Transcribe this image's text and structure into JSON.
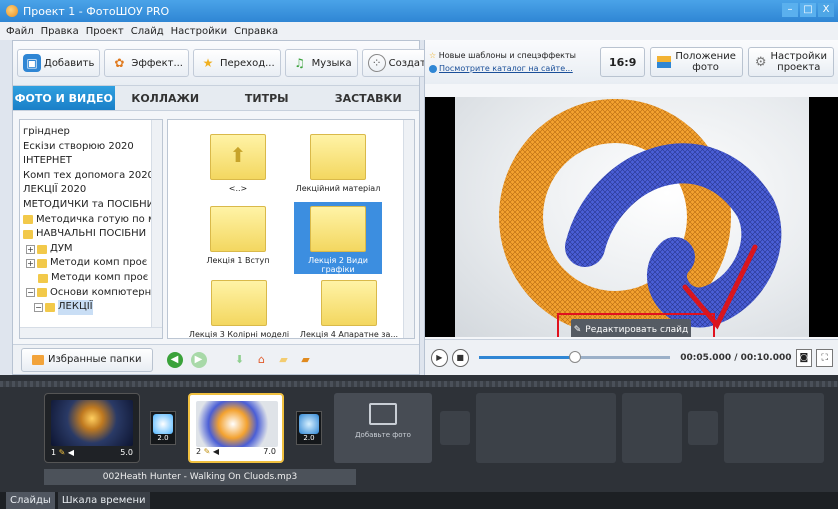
{
  "window": {
    "title": "Проект 1 - ФотоШОУ PRO",
    "controls": [
      "–",
      "□",
      "X"
    ]
  },
  "menu": [
    "Файл",
    "Правка",
    "Проект",
    "Слайд",
    "Настройки",
    "Справка"
  ],
  "toolbar": {
    "add": "Добавить",
    "effects": "Эффект...",
    "transitions": "Переход...",
    "music": "Музыка",
    "create": "Создать"
  },
  "tabs": [
    "ФОТО И ВИДЕО",
    "КОЛЛАЖИ",
    "ТИТРЫ",
    "ЗАСТАВКИ"
  ],
  "tree": [
    {
      "label": "грінднер",
      "type": "plain"
    },
    {
      "label": "Ескізи створюю 2020",
      "type": "plain"
    },
    {
      "label": "ІНТЕРНЕТ",
      "type": "plain"
    },
    {
      "label": "Комп тех допомога 2020",
      "type": "plain"
    },
    {
      "label": "ЛЕКЦІЇ  2020",
      "type": "plain"
    },
    {
      "label": "МЕТОДИЧКИ та ПОСІБНИ",
      "type": "plain"
    },
    {
      "label": "Методичка готую по м",
      "type": "folder"
    },
    {
      "label": "НАВЧАЛЬНІ ПОСІБНИ",
      "type": "folder"
    },
    {
      "label": "ДУМ",
      "type": "expand-folder"
    },
    {
      "label": "Методи комп проє",
      "type": "expand-folder"
    },
    {
      "label": "Методи комп проє",
      "type": "folder-indent"
    },
    {
      "label": "Основи компютерн",
      "type": "collapse-folder"
    },
    {
      "label": "ЛЕКЦІЇ",
      "type": "selected"
    }
  ],
  "thumbnails": [
    {
      "label": "<..>",
      "up": true,
      "selected": false
    },
    {
      "label": "Лекційний матеріал",
      "up": false,
      "selected": false
    },
    {
      "label": "Лекція 1 Вступ",
      "up": false,
      "selected": false
    },
    {
      "label": "Лекція 2 Види графіки",
      "up": false,
      "selected": true
    },
    {
      "label": "Лекція 3 Колірні моделі",
      "up": false,
      "selected": false
    },
    {
      "label": "Лекція 4 Апаратне за...",
      "up": false,
      "selected": false
    }
  ],
  "left_bottom": {
    "favorites": "Избранные папки"
  },
  "right_toolbar": {
    "promo_line1": "Новые шаблоны и спецэффекты",
    "promo_line2": "Посмотрите каталог на сайте...",
    "ratio": "16:9",
    "photo_position_1": "Положение",
    "photo_position_2": "фото",
    "project_settings_1": "Настройки",
    "project_settings_2": "проекта"
  },
  "preview": {
    "edit_slide": "Редактировать слайд"
  },
  "player": {
    "timecode": "00:05.000 / 00:10.000",
    "progress": 0.5
  },
  "slides": [
    {
      "number": "1",
      "duration": "5.0"
    },
    {
      "number": "2",
      "duration": "7.0"
    }
  ],
  "transitions": [
    {
      "duration": "2.0"
    },
    {
      "duration": "2.0"
    }
  ],
  "timeline": {
    "add_photo": "Добавьте фото",
    "audio_track": "002Heath Hunter - Walking On Cluods.mp3"
  },
  "bottom_tabs": [
    "Слайды",
    "Шкала времени"
  ],
  "colors": {
    "accent": "#1a7fc8",
    "highlight": "#e0111e",
    "selection": "#3c8ee0"
  }
}
